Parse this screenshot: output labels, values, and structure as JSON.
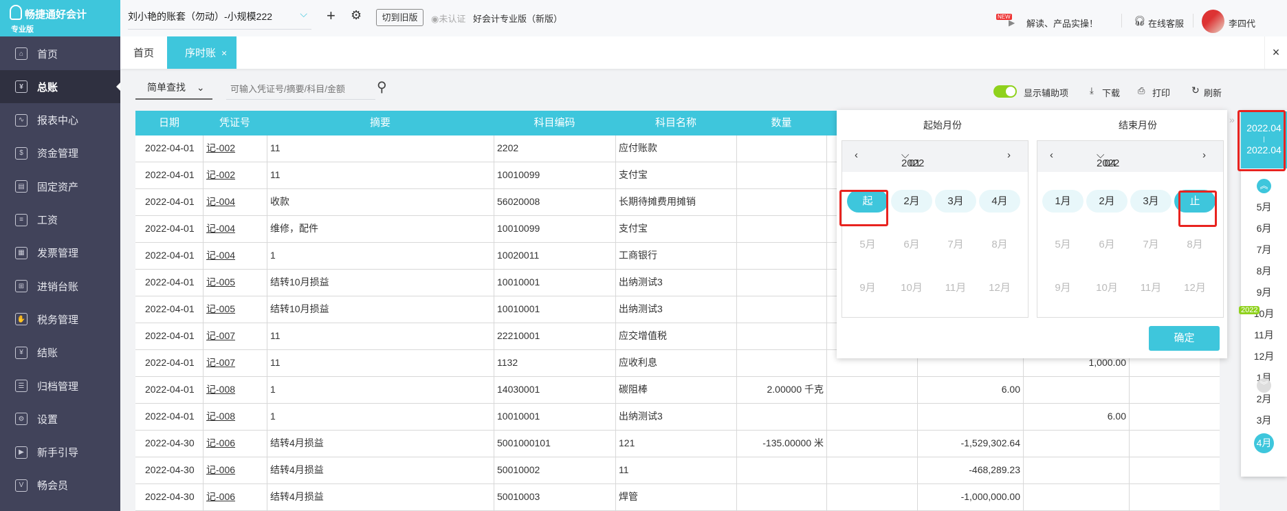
{
  "brand": {
    "name": "畅捷通好会计",
    "edition": "专业版"
  },
  "topbar": {
    "account": "刘小艳的账套（勿动）-小规模222",
    "switch_old": "切到旧版",
    "cert": "未认证",
    "product": "好会计专业版（新版）",
    "news": "解读、产品实操！",
    "news_badge": "NEW",
    "service": "在线客服",
    "user": "李四代"
  },
  "sidebar": {
    "items": [
      {
        "label": "首页",
        "icon": "home-icon"
      },
      {
        "label": "总账",
        "icon": "ledger-icon"
      },
      {
        "label": "报表中心",
        "icon": "chart-icon"
      },
      {
        "label": "资金管理",
        "icon": "money-icon"
      },
      {
        "label": "固定资产",
        "icon": "asset-icon"
      },
      {
        "label": "工资",
        "icon": "salary-icon"
      },
      {
        "label": "发票管理",
        "icon": "invoice-icon"
      },
      {
        "label": "进销台账",
        "icon": "inventory-icon"
      },
      {
        "label": "税务管理",
        "icon": "tax-icon"
      },
      {
        "label": "结账",
        "icon": "close-books-icon"
      },
      {
        "label": "归档管理",
        "icon": "archive-icon"
      },
      {
        "label": "设置",
        "icon": "gear-icon"
      },
      {
        "label": "新手引导",
        "icon": "guide-icon"
      },
      {
        "label": "畅会员",
        "icon": "vip-icon"
      }
    ]
  },
  "tabs": {
    "home": "首页",
    "active": "序时账",
    "close": "×",
    "close_all": "×"
  },
  "toolbar": {
    "search_mode": "简单查找",
    "search_placeholder": "可输入凭证号/摘要/科目/金额",
    "toggle_label": "显示辅助项",
    "toggle_on": true,
    "download": "下载",
    "print": "打印",
    "refresh": "刷新"
  },
  "table": {
    "headers": [
      "日期",
      "凭证号",
      "摘要",
      "科目编码",
      "科目名称",
      "数量",
      "",
      "",
      "",
      ""
    ],
    "rows": [
      [
        "2022-04-01",
        "记-002",
        "11",
        "2202",
        "应付账款",
        "",
        "",
        "",
        "",
        ""
      ],
      [
        "2022-04-01",
        "记-002",
        "11",
        "10010099",
        "支付宝",
        "",
        "",
        "",
        "",
        ""
      ],
      [
        "2022-04-01",
        "记-004",
        "收款",
        "56020008",
        "长期待摊费用摊销",
        "",
        "",
        "",
        "",
        ""
      ],
      [
        "2022-04-01",
        "记-004",
        "维修，配件",
        "10010099",
        "支付宝",
        "",
        "",
        "",
        "",
        ""
      ],
      [
        "2022-04-01",
        "记-004",
        "1",
        "10020011",
        "工商银行",
        "",
        "",
        "",
        "",
        ""
      ],
      [
        "2022-04-01",
        "记-005",
        "结转10月损益",
        "10010001",
        "出纳测试3",
        "",
        "",
        "",
        "",
        ""
      ],
      [
        "2022-04-01",
        "记-005",
        "结转10月损益",
        "10010001",
        "出纳测试3",
        "",
        "",
        "",
        "",
        ""
      ],
      [
        "2022-04-01",
        "记-007",
        "11",
        "22210001",
        "应交增值税",
        "",
        "",
        "",
        "",
        ""
      ],
      [
        "2022-04-01",
        "记-007",
        "11",
        "1132",
        "应收利息",
        "",
        "",
        "",
        "1,000.00",
        ""
      ],
      [
        "2022-04-01",
        "记-008",
        "1",
        "14030001",
        "碳阻棒",
        "2.00000 千克",
        "",
        "6.00",
        "",
        ""
      ],
      [
        "2022-04-01",
        "记-008",
        "1",
        "10010001",
        "出纳测试3",
        "",
        "",
        "",
        "6.00",
        ""
      ],
      [
        "2022-04-30",
        "记-006",
        "结转4月损益",
        "5001000101",
        "121",
        "-135.00000 米",
        "",
        "-1,529,302.64",
        "",
        ""
      ],
      [
        "2022-04-30",
        "记-006",
        "结转4月损益",
        "50010002",
        "11",
        "",
        "",
        "-468,289.23",
        "",
        ""
      ],
      [
        "2022-04-30",
        "记-006",
        "结转4月损益",
        "50010003",
        "焊管",
        "",
        "",
        "-1,000,000.00",
        "",
        ""
      ]
    ]
  },
  "picker": {
    "start_title": "起始月份",
    "end_title": "结束月份",
    "start_year": "2022",
    "start_month": "01",
    "end_year": "2022",
    "end_month": "04",
    "confirm": "确定",
    "start_months": [
      {
        "l": "起",
        "s": "sel"
      },
      {
        "l": "2月",
        "s": "en"
      },
      {
        "l": "3月",
        "s": "en"
      },
      {
        "l": "4月",
        "s": "en"
      },
      {
        "l": "5月",
        "s": "dis"
      },
      {
        "l": "6月",
        "s": "dis"
      },
      {
        "l": "7月",
        "s": "dis"
      },
      {
        "l": "8月",
        "s": "dis"
      },
      {
        "l": "9月",
        "s": "dis"
      },
      {
        "l": "10月",
        "s": "dis"
      },
      {
        "l": "11月",
        "s": "dis"
      },
      {
        "l": "12月",
        "s": "dis"
      }
    ],
    "end_months": [
      {
        "l": "1月",
        "s": "en"
      },
      {
        "l": "2月",
        "s": "en"
      },
      {
        "l": "3月",
        "s": "en"
      },
      {
        "l": "止",
        "s": "sel"
      },
      {
        "l": "5月",
        "s": "dis"
      },
      {
        "l": "6月",
        "s": "dis"
      },
      {
        "l": "7月",
        "s": "dis"
      },
      {
        "l": "8月",
        "s": "dis"
      },
      {
        "l": "9月",
        "s": "dis"
      },
      {
        "l": "10月",
        "s": "dis"
      },
      {
        "l": "11月",
        "s": "dis"
      },
      {
        "l": "12月",
        "s": "dis"
      }
    ]
  },
  "period": {
    "from": "2022.04",
    "sep": "|",
    "to": "2022.04",
    "year_badge": "2022",
    "months": [
      "5月",
      "6月",
      "7月",
      "8月",
      "9月",
      "10月",
      "11月",
      "12月",
      "1月",
      "2月",
      "3月",
      "4月"
    ],
    "selected": "4月"
  },
  "colors": {
    "accent": "#3ec6dc",
    "sidebar": "#41435a",
    "highlight": "#e8231f",
    "toggle": "#8fd11c"
  }
}
